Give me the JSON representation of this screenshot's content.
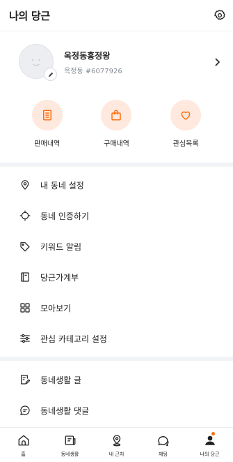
{
  "header": {
    "title": "나의 당근",
    "settings_icon": "gear-icon"
  },
  "profile": {
    "name": "옥정동흥정왕",
    "sub": "옥정동 #6077926"
  },
  "quick_actions": [
    {
      "label": "판매내역",
      "icon": "receipt-icon"
    },
    {
      "label": "구매내역",
      "icon": "shopping-bag-icon"
    },
    {
      "label": "관심목록",
      "icon": "heart-icon"
    }
  ],
  "menu_main": [
    {
      "label": "내 동네 설정",
      "icon": "location-pin-icon"
    },
    {
      "label": "동네 인증하기",
      "icon": "crosshair-icon"
    },
    {
      "label": "키워드 알림",
      "icon": "tag-icon"
    },
    {
      "label": "당근가계부",
      "icon": "ledger-icon"
    },
    {
      "label": "모아보기",
      "icon": "grid-icon"
    },
    {
      "label": "관심 카테고리 설정",
      "icon": "sliders-icon"
    }
  ],
  "menu_community": [
    {
      "label": "동네생활 글",
      "icon": "edit-note-icon"
    },
    {
      "label": "동네생활 댓글",
      "icon": "comment-icon"
    }
  ],
  "tabs": [
    {
      "label": "홈",
      "icon": "home-icon"
    },
    {
      "label": "동네생활",
      "icon": "newspaper-icon"
    },
    {
      "label": "내 근처",
      "icon": "location-icon"
    },
    {
      "label": "채팅",
      "icon": "chat-icon"
    },
    {
      "label": "나의 당근",
      "icon": "person-icon"
    }
  ],
  "colors": {
    "accent": "#ff6f0f",
    "accent_soft": "#ffe8dd",
    "background": "#f2f3f6"
  }
}
